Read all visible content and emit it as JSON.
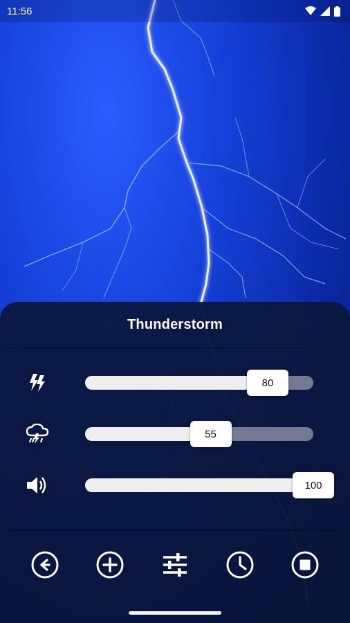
{
  "status_bar": {
    "time": "11:56",
    "icons": [
      "wifi-icon",
      "signal-icon",
      "battery-icon"
    ]
  },
  "panel": {
    "title": "Thunderstorm"
  },
  "sliders": [
    {
      "icon": "lightning-icon",
      "value": 80,
      "label": "80"
    },
    {
      "icon": "storm-cloud-icon",
      "value": 55,
      "label": "55"
    },
    {
      "icon": "volume-icon",
      "value": 100,
      "label": "100"
    }
  ],
  "toolbar": {
    "buttons": [
      "back-icon",
      "add-icon",
      "equalizer-icon",
      "timer-icon",
      "stop-icon"
    ]
  },
  "colors": {
    "panel_bg": "#0a163a",
    "sky": "#1540d8",
    "thumb": "#ffffff",
    "track": "#c8cdd7"
  }
}
